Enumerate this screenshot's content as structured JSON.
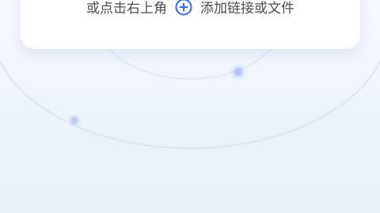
{
  "upload_card": {
    "hint_prefix": "或点击右上角",
    "hint_suffix": "添加链接或文件",
    "add_icon": "plus-circle-icon"
  },
  "colors": {
    "accent": "#3568e6",
    "background": "#eef4fd",
    "card": "#ffffff",
    "text": "#4a4d55"
  }
}
